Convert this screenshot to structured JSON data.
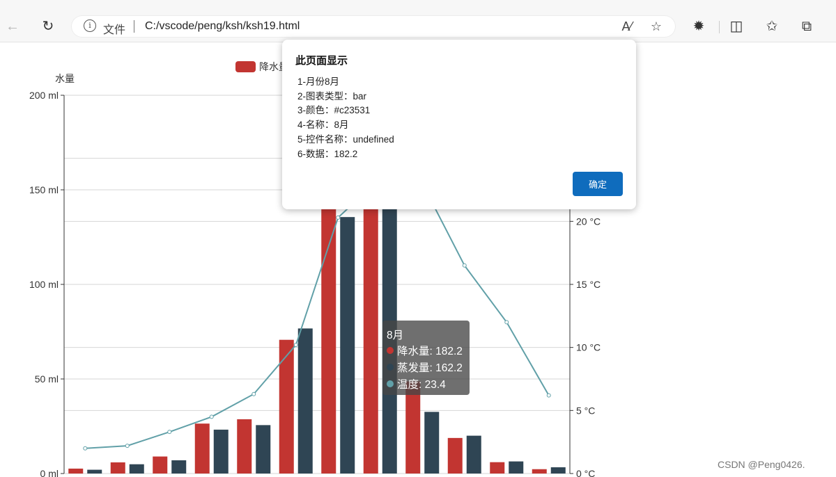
{
  "browser": {
    "file_label": "文件",
    "url": "C:/vscode/peng/ksh/ksh19.html"
  },
  "dialog": {
    "title": "此页面显示",
    "lines": [
      "1-月份8月",
      "2-图表类型：bar",
      "3-颜色：#c23531",
      "4-名称：8月",
      "5-控件名称：undefined",
      "6-数据：182.2"
    ],
    "ok_label": "确定"
  },
  "tooltip": {
    "title": "8月",
    "rows": [
      {
        "label": "降水量: 182.2",
        "color": "#c23531"
      },
      {
        "label": "蒸发量: 162.2",
        "color": "#2f4554"
      },
      {
        "label": "温度: 23.4",
        "color": "#61a0a8"
      }
    ]
  },
  "watermark": "CSDN @Peng0426.",
  "chart_data": {
    "type": "bar",
    "legend": [
      "降水量"
    ],
    "y_left": {
      "label": "水量",
      "ticks": [
        "0  ml",
        "50  ml",
        "100  ml",
        "150  ml",
        "200  ml"
      ],
      "min": 0,
      "max": 200
    },
    "y_right": {
      "ticks": [
        "0 °C",
        "5 °C",
        "10 °C",
        "15 °C",
        "20 °C"
      ],
      "min": 0,
      "max": 30
    },
    "series": [
      {
        "name": "降水量",
        "kind": "bar",
        "color": "#c23531",
        "values": [
          2.6,
          5.9,
          9.0,
          26.4,
          28.7,
          70.7,
          175.6,
          182.2,
          48.7,
          18.8,
          6.0,
          2.3
        ]
      },
      {
        "name": "蒸发量",
        "kind": "bar",
        "color": "#2f4554",
        "values": [
          2.0,
          4.9,
          7.0,
          23.2,
          25.6,
          76.7,
          135.6,
          162.2,
          32.6,
          20.0,
          6.4,
          3.3
        ]
      },
      {
        "name": "温度",
        "kind": "line",
        "axis": "right",
        "color": "#61a0a8",
        "values": [
          2.0,
          2.2,
          3.3,
          4.5,
          6.3,
          10.2,
          20.3,
          23.4,
          23.0,
          16.5,
          12.0,
          6.2
        ]
      }
    ]
  }
}
